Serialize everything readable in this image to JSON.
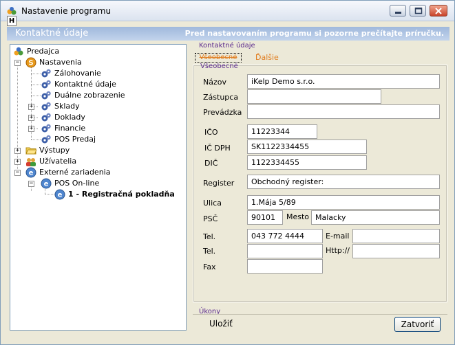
{
  "window": {
    "title": "Nastavenie programu",
    "menu_key": "H"
  },
  "header": {
    "title": "Kontaktné údaje",
    "notice": "Pred nastavovaním programu si pozorne prečítajte príručku."
  },
  "tree": {
    "items": [
      {
        "label": "Predajca",
        "icon": "users-icon"
      },
      {
        "label": "Nastavenia",
        "icon": "settings-icon"
      },
      {
        "label": "Zálohovanie",
        "icon": "gear-icon"
      },
      {
        "label": "Kontaktné údaje",
        "icon": "gear-icon"
      },
      {
        "label": "Duálne zobrazenie",
        "icon": "gear-icon"
      },
      {
        "label": "Sklady",
        "icon": "gear-icon"
      },
      {
        "label": "Doklady",
        "icon": "gear-icon"
      },
      {
        "label": "Financie",
        "icon": "gear-icon"
      },
      {
        "label": "POS Predaj",
        "icon": "gear-icon"
      },
      {
        "label": "Výstupy",
        "icon": "folder-icon"
      },
      {
        "label": "Užívatelia",
        "icon": "users-icon"
      },
      {
        "label": "Externé zariadenia",
        "icon": "device-icon"
      },
      {
        "label": "POS On-line",
        "icon": "device-icon"
      },
      {
        "label": "1 - Registračná pokladňa",
        "icon": "device-icon"
      }
    ]
  },
  "form": {
    "group_title": "Kontaktné údaje",
    "tabs": [
      "Všeobecné",
      "Ďalšie"
    ],
    "section_title": "Všeobecné",
    "fields": {
      "nazov": {
        "label": "Názov",
        "value": "iKelp Demo s.r.o."
      },
      "zastupca": {
        "label": "Zástupca",
        "value": ""
      },
      "prevadzka": {
        "label": "Prevádzka",
        "value": ""
      },
      "ico": {
        "label": "IČO",
        "value": "11223344"
      },
      "icdph": {
        "label": "IČ DPH",
        "value": "SK1122334455"
      },
      "dic": {
        "label": "DIČ",
        "value": "1122334455"
      },
      "register": {
        "label": "Register",
        "value": "Obchodný register:"
      },
      "ulica": {
        "label": "Ulica",
        "value": "1.Mája 5/89"
      },
      "psc": {
        "label": "PSČ",
        "value": "90101"
      },
      "mesto": {
        "label": "Mesto",
        "value": "Malacky"
      },
      "tel1": {
        "label": "Tel.",
        "value": "043 772 4444"
      },
      "email": {
        "label": "E-mail",
        "value": ""
      },
      "tel2": {
        "label": "Tel.",
        "value": ""
      },
      "http": {
        "label": "Http://",
        "value": ""
      },
      "fax": {
        "label": "Fax",
        "value": ""
      }
    }
  },
  "actions": {
    "group_title": "Úkony",
    "save_label": "Uložiť",
    "close_label": "Zatvoriť"
  }
}
